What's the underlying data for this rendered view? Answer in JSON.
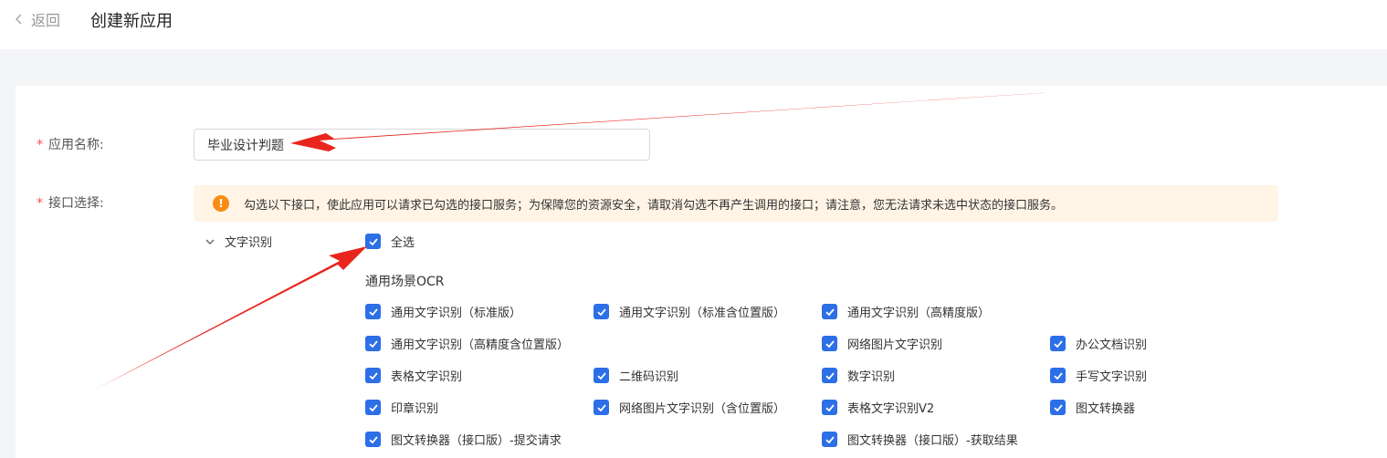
{
  "header": {
    "back_label": "返回",
    "title": "创建新应用"
  },
  "form": {
    "name_label": "应用名称:",
    "name_value": "毕业设计判题",
    "api_label": "接口选择:",
    "required_mark": "*"
  },
  "notice": {
    "text": "勾选以下接口，使此应用可以请求已勾选的接口服务；为保障您的资源安全，请取消勾选不再产生调用的接口；请注意，您无法请求未选中状态的接口服务。"
  },
  "category": {
    "label": "文字识别",
    "select_all": "全选",
    "section": "通用场景OCR"
  },
  "apis": [
    {
      "label": "通用文字识别（标准版）",
      "checked": true
    },
    {
      "label": "通用文字识别（标准含位置版）",
      "checked": true
    },
    {
      "label": "通用文字识别（高精度版）",
      "checked": true
    },
    {
      "label": "通用文字识别（高精度含位置版）",
      "checked": true
    },
    {
      "label": "网络图片文字识别",
      "checked": true
    },
    {
      "label": "办公文档识别",
      "checked": true
    },
    {
      "label": "表格文字识别",
      "checked": true
    },
    {
      "label": "二维码识别",
      "checked": true
    },
    {
      "label": "数字识别",
      "checked": true
    },
    {
      "label": "手写文字识别",
      "checked": true
    },
    {
      "label": "印章识别",
      "checked": true
    },
    {
      "label": "网络图片文字识别（含位置版）",
      "checked": true
    },
    {
      "label": "表格文字识别V2",
      "checked": true
    },
    {
      "label": "图文转换器",
      "checked": true
    },
    {
      "label": "图文转换器（接口版）-提交请求",
      "checked": true
    },
    {
      "label": "图文转换器（接口版）-获取结果",
      "checked": true
    }
  ],
  "colors": {
    "checkbox": "#2c6fe6",
    "required": "#ff4d4f",
    "notice_bg": "#fff4e6",
    "warning": "#fa8c16",
    "annotation_arrow": "#e8261d"
  }
}
